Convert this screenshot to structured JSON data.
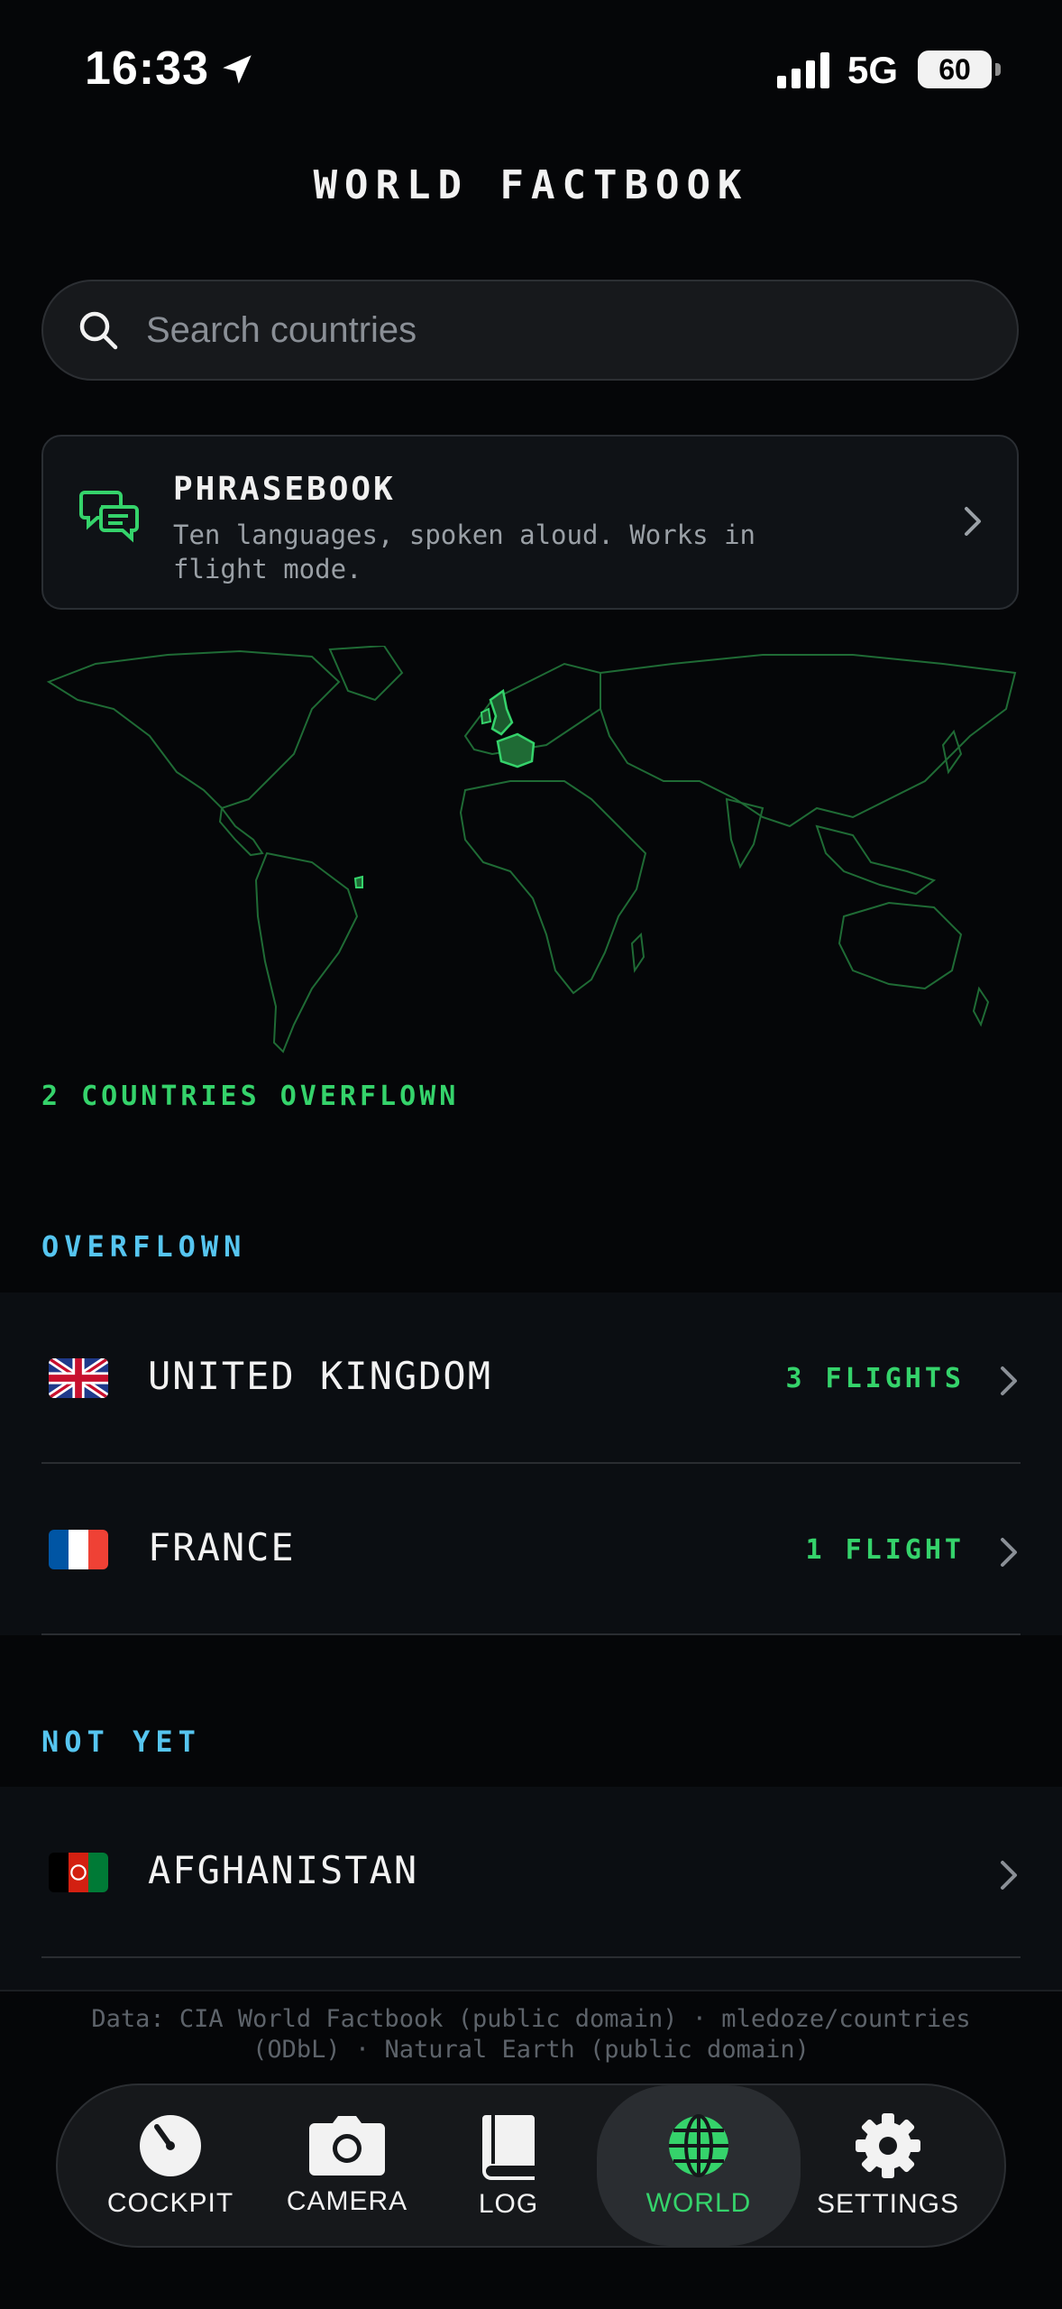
{
  "status_bar": {
    "time": "16:33",
    "network": "5G",
    "battery": "60"
  },
  "header": {
    "title": "WORLD FACTBOOK"
  },
  "search": {
    "placeholder": "Search countries",
    "value": ""
  },
  "phrasebook": {
    "title": "PHRASEBOOK",
    "subtitle": "Ten languages, spoken aloud. Works in flight mode."
  },
  "map": {
    "highlight_color": "#35d36b",
    "outline_color": "#1f6b35"
  },
  "summary": {
    "countries_overflown": "2 COUNTRIES OVERFLOWN"
  },
  "overflown": {
    "label": "OVERFLOWN",
    "items": [
      {
        "name": "UNITED KINGDOM",
        "flights": "3 FLIGHTS",
        "flag": "uk-flag"
      },
      {
        "name": "FRANCE",
        "flights": "1 FLIGHT",
        "flag": "france-flag"
      }
    ]
  },
  "not_yet": {
    "label": "NOT YET",
    "items": [
      {
        "name": "AFGHANISTAN",
        "flights": "",
        "flag": "afghanistan-flag"
      }
    ]
  },
  "credits": "Data: CIA World Factbook (public domain) · mledoze/countries (ODbL) · Natural Earth (public domain)",
  "tabs": [
    {
      "label": "COCKPIT",
      "icon": "gauge-icon"
    },
    {
      "label": "CAMERA",
      "icon": "camera-icon"
    },
    {
      "label": "LOG",
      "icon": "book-icon"
    },
    {
      "label": "WORLD",
      "icon": "globe-icon",
      "active": true
    },
    {
      "label": "SETTINGS",
      "icon": "gear-icon"
    }
  ],
  "colors": {
    "accent_green": "#35d36b",
    "section_blue": "#56c5f0",
    "background": "#050608"
  }
}
